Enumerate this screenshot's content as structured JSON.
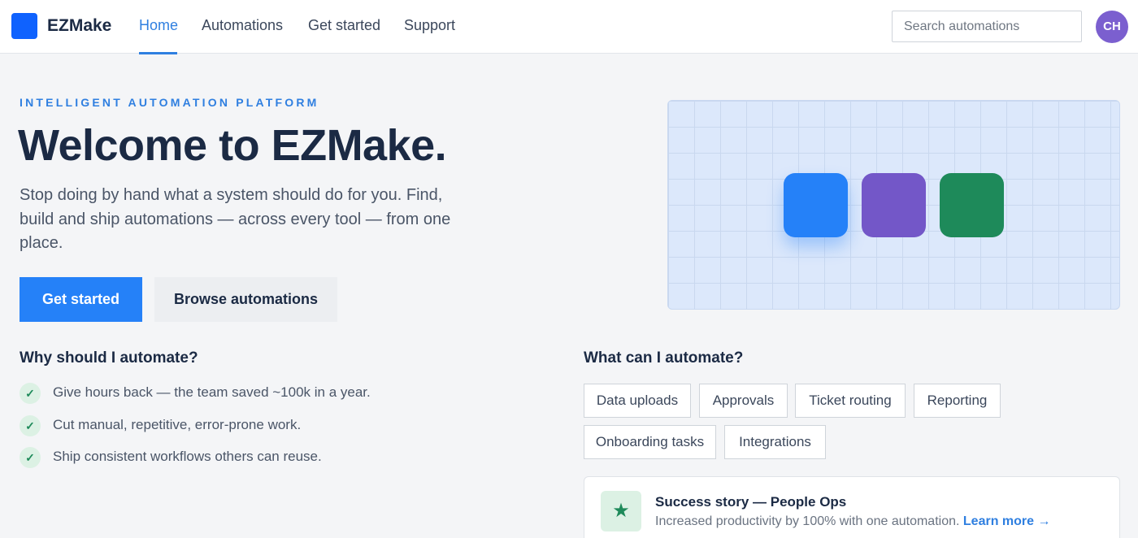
{
  "brand": {
    "name": "EZMake",
    "accent": "#2581f8"
  },
  "nav": {
    "items": [
      {
        "label": "Home",
        "active": true
      },
      {
        "label": "Automations",
        "active": false
      },
      {
        "label": "Get started",
        "active": false
      },
      {
        "label": "Support",
        "active": false
      }
    ]
  },
  "search": {
    "placeholder": "Search automations",
    "value": ""
  },
  "user": {
    "initials": "CH"
  },
  "hero": {
    "eyebrow": "INTELLIGENT AUTOMATION PLATFORM",
    "title": "Welcome to EZMake.",
    "subtitle": "Stop doing by hand what a system should do for you. Find, build and ship automations — across every tool — from one place.",
    "primary_cta": "Get started",
    "secondary_cta": "Browse automations"
  },
  "illustration": {
    "tile_colors": [
      "#2581f8",
      "#7357c8",
      "#1e8a5a"
    ]
  },
  "why": {
    "title": "Why should I automate?",
    "items": [
      "Give hours back — the team saved ~100k in a year.",
      "Cut manual, repetitive, error-prone work.",
      "Ship consistent workflows others can reuse."
    ],
    "check_icon": "checkmark-icon"
  },
  "what": {
    "title": "What can I automate?",
    "tags": [
      "Data uploads",
      "Approvals",
      "Ticket routing",
      "Reporting",
      "Onboarding tasks",
      "Integrations"
    ]
  },
  "success": {
    "icon": "star-icon",
    "title": "Success story — People Ops",
    "description": "Increased productivity by 100% with one automation.",
    "link": "Learn more →"
  }
}
